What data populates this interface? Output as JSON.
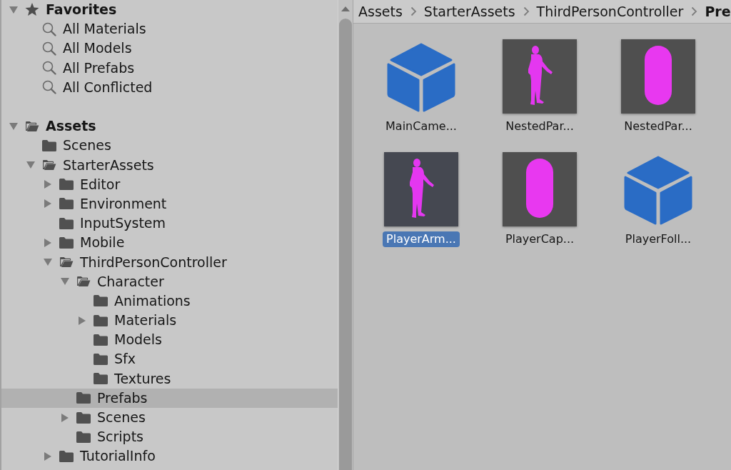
{
  "project_tree": [
    {
      "label": "Favorites",
      "kind": "favorites",
      "expanded": true,
      "selected": false,
      "children": [
        {
          "label": "All Materials",
          "kind": "search",
          "selected": false
        },
        {
          "label": "All Models",
          "kind": "search",
          "selected": false
        },
        {
          "label": "All Prefabs",
          "kind": "search",
          "selected": false
        },
        {
          "label": "All Conflicted",
          "kind": "search",
          "selected": false
        }
      ]
    },
    {
      "label": "Assets",
      "kind": "folder",
      "expanded": true,
      "selected": false,
      "children": [
        {
          "label": "Scenes",
          "kind": "folder",
          "selected": false
        },
        {
          "label": "StarterAssets",
          "kind": "folder",
          "expanded": true,
          "selected": false,
          "children": [
            {
              "label": "Editor",
              "kind": "folder",
              "expanded": false,
              "selected": false
            },
            {
              "label": "Environment",
              "kind": "folder",
              "expanded": false,
              "selected": false
            },
            {
              "label": "InputSystem",
              "kind": "folder",
              "selected": false
            },
            {
              "label": "Mobile",
              "kind": "folder",
              "expanded": false,
              "selected": false
            },
            {
              "label": "ThirdPersonController",
              "kind": "folder",
              "expanded": true,
              "selected": false,
              "children": [
                {
                  "label": "Character",
                  "kind": "folder",
                  "expanded": true,
                  "selected": false,
                  "children": [
                    {
                      "label": "Animations",
                      "kind": "folder",
                      "selected": false
                    },
                    {
                      "label": "Materials",
                      "kind": "folder",
                      "expanded": false,
                      "selected": false
                    },
                    {
                      "label": "Models",
                      "kind": "folder",
                      "selected": false
                    },
                    {
                      "label": "Sfx",
                      "kind": "folder",
                      "selected": false
                    },
                    {
                      "label": "Textures",
                      "kind": "folder",
                      "selected": false
                    }
                  ]
                },
                {
                  "label": "Prefabs",
                  "kind": "folder",
                  "selected": true
                },
                {
                  "label": "Scenes",
                  "kind": "folder",
                  "expanded": false,
                  "selected": false
                },
                {
                  "label": "Scripts",
                  "kind": "folder",
                  "selected": false
                }
              ]
            },
            {
              "label": "TutorialInfo",
              "kind": "folder",
              "expanded": false,
              "selected": false
            }
          ]
        }
      ]
    }
  ],
  "breadcrumb": [
    {
      "label": "Assets",
      "current": false
    },
    {
      "label": "StarterAssets",
      "current": false
    },
    {
      "label": "ThirdPersonController",
      "current": false
    },
    {
      "label": "Pre",
      "current": true
    }
  ],
  "assets_grid": [
    {
      "label": "MainCame...",
      "kind": "cube",
      "selected": false
    },
    {
      "label": "NestedPar...",
      "kind": "figure",
      "selected": false
    },
    {
      "label": "NestedPar...",
      "kind": "capsule",
      "selected": false
    },
    {
      "label": "PlayerArm...",
      "kind": "figure",
      "selected": true
    },
    {
      "label": "PlayerCap...",
      "kind": "capsule",
      "selected": false
    },
    {
      "label": "PlayerFoll...",
      "kind": "cube",
      "selected": false
    }
  ]
}
